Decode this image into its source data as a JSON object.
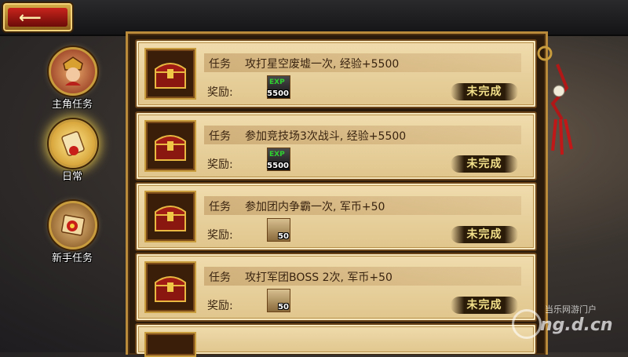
{
  "header": {
    "back_icon": "back-arrow-icon"
  },
  "nav": [
    {
      "label": "主角任务",
      "icon": "hero-portrait-icon",
      "active": false
    },
    {
      "label": "日常",
      "icon": "scroll-icon",
      "active": true
    },
    {
      "label": "新手任务",
      "icon": "map-scroll-icon",
      "active": false
    }
  ],
  "tasks": [
    {
      "type": "任务",
      "desc": "攻打星空废墟一次, 经验+5500",
      "reward_label": "奖励:",
      "reward_kind": "exp",
      "reward_tag": "EXP",
      "reward_qty": "5500",
      "status": "未完成"
    },
    {
      "type": "任务",
      "desc": "参加竞技场3次战斗, 经验+5500",
      "reward_label": "奖励:",
      "reward_kind": "exp",
      "reward_tag": "EXP",
      "reward_qty": "5500",
      "status": "未完成"
    },
    {
      "type": "任务",
      "desc": "参加团内争霸一次, 军币+50",
      "reward_label": "奖励:",
      "reward_kind": "coin",
      "reward_tag": "",
      "reward_qty": "50",
      "status": "未完成"
    },
    {
      "type": "任务",
      "desc": "攻打军团BOSS  2次, 军币+50",
      "reward_label": "奖励:",
      "reward_kind": "coin",
      "reward_tag": "",
      "reward_qty": "50",
      "status": "未完成"
    }
  ],
  "watermark": {
    "cn": "当乐网游门户",
    "domain": "ng.d.cn"
  },
  "colors": {
    "card_bg": "#e8d09c",
    "status_text": "#f3e08a",
    "frame_gold": "#c89b3c"
  }
}
